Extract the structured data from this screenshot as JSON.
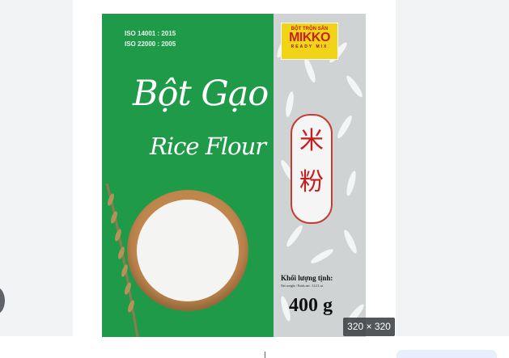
{
  "product": {
    "iso_lines": [
      "ISO 14001 : 2015",
      "ISO 22000 : 2005"
    ],
    "title_vietnamese": "Bột Gạo",
    "title_english": "Rice Flour",
    "brand": {
      "top": "BỘT TRỘN SẴN",
      "name": "MIKKO",
      "sub": "READY MIX"
    },
    "chinese": [
      "米",
      "粉"
    ],
    "weight_label": "Khối lượng tịnh:",
    "weight_subtitle": "Net weight / Poids net : 14.11 oz",
    "weight_value": "400 g"
  },
  "viewer": {
    "size_badge": "320 × 320"
  },
  "colors": {
    "green": "#1f9a49",
    "brand_yellow": "#f1d317",
    "brand_red": "#c6211b",
    "viewer_gray": "#f1f3f4"
  }
}
